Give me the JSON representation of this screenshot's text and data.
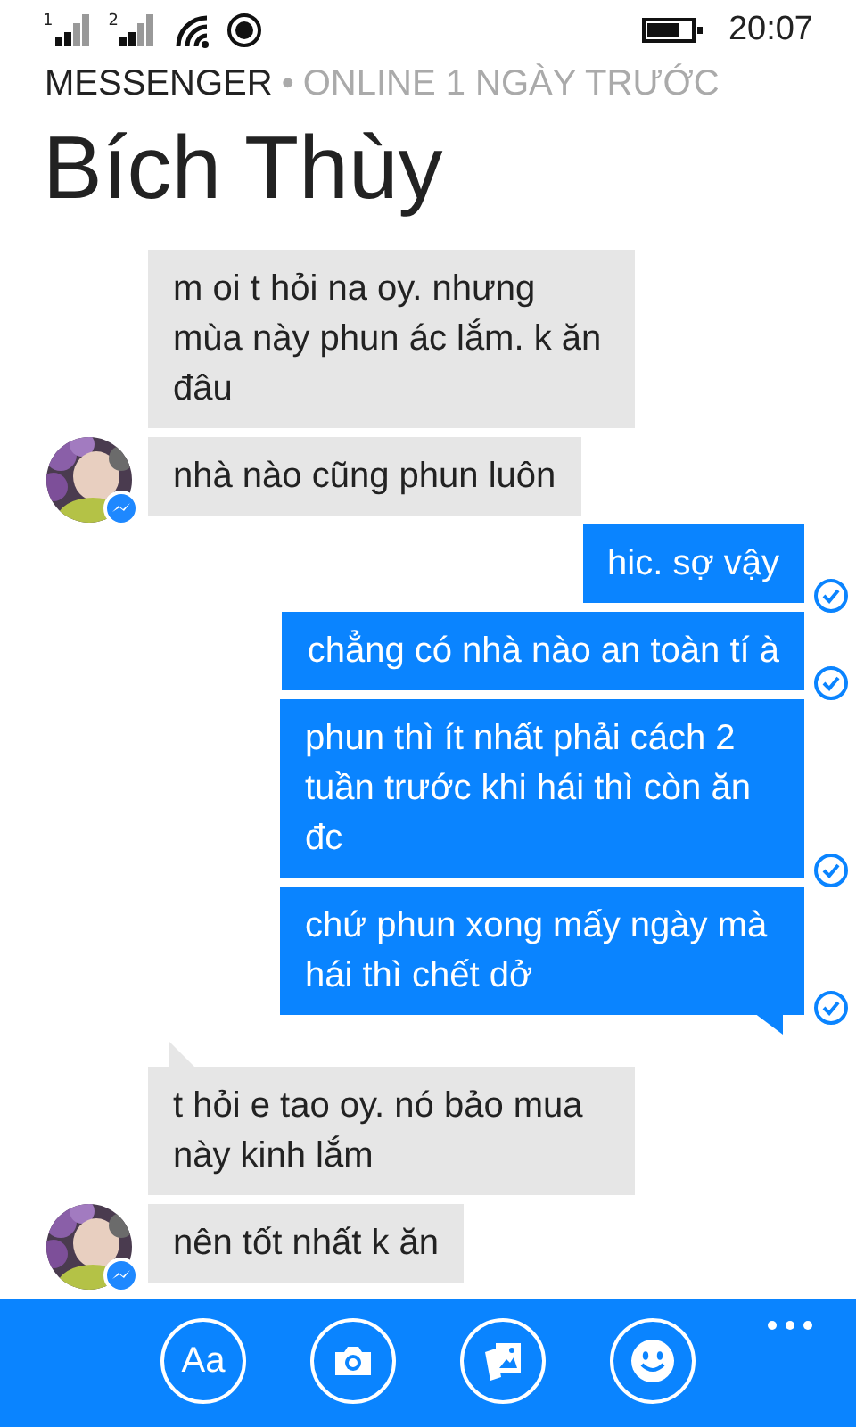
{
  "status_bar": {
    "signals": [
      {
        "sim": "1"
      },
      {
        "sim": "2"
      }
    ],
    "time": "20:07"
  },
  "header": {
    "app": "MESSENGER",
    "separator": "•",
    "status": "ONLINE 1 NGÀY TRƯỚC"
  },
  "contact": {
    "name": "Bích Thùy"
  },
  "messages": [
    {
      "kind": "incoming",
      "text": "m oi t hỏi na oy. nhưng mùa này phun ác lắm. k ăn đâu",
      "avatar": false,
      "tail": false
    },
    {
      "kind": "incoming",
      "text": "nhà nào cũng phun luôn",
      "avatar": true,
      "tail": false
    },
    {
      "kind": "outgoing",
      "text": "hic. sợ vậy",
      "tail": false,
      "delivered": true
    },
    {
      "kind": "outgoing",
      "text": "chẳng có nhà nào an toàn tí à",
      "tail": false,
      "delivered": true
    },
    {
      "kind": "outgoing",
      "text": "phun thì ít nhất phải cách 2 tuần trước khi hái thì còn ăn đc",
      "tail": false,
      "delivered": true
    },
    {
      "kind": "outgoing",
      "text": "chứ phun xong mấy ngày mà hái thì chết dở",
      "tail": true,
      "delivered": true
    },
    {
      "kind": "incoming",
      "text": "t hỏi e tao oy. nó bảo mua này kinh lắm",
      "avatar": false,
      "tail": true
    },
    {
      "kind": "incoming",
      "text": "nên tốt nhất k ăn",
      "avatar": true,
      "tail": false
    }
  ],
  "app_bar": {
    "buttons": [
      {
        "kind": "text",
        "label": "Aa"
      },
      {
        "kind": "camera"
      },
      {
        "kind": "photos"
      },
      {
        "kind": "emoji"
      }
    ]
  }
}
